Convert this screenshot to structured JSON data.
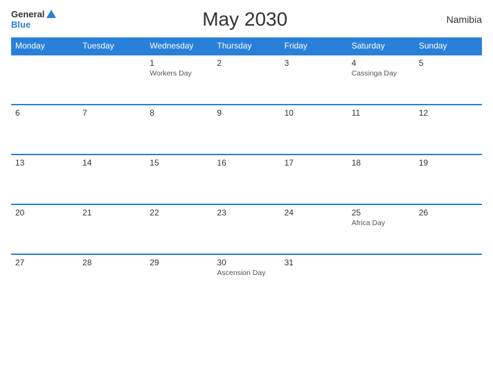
{
  "header": {
    "logo_general": "General",
    "logo_blue": "Blue",
    "title": "May 2030",
    "country": "Namibia"
  },
  "days_of_week": [
    "Monday",
    "Tuesday",
    "Wednesday",
    "Thursday",
    "Friday",
    "Saturday",
    "Sunday"
  ],
  "weeks": [
    [
      {
        "day": "",
        "holiday": ""
      },
      {
        "day": "",
        "holiday": ""
      },
      {
        "day": "1",
        "holiday": "Workers Day"
      },
      {
        "day": "2",
        "holiday": ""
      },
      {
        "day": "3",
        "holiday": ""
      },
      {
        "day": "4",
        "holiday": "Cassinga Day"
      },
      {
        "day": "5",
        "holiday": ""
      }
    ],
    [
      {
        "day": "6",
        "holiday": ""
      },
      {
        "day": "7",
        "holiday": ""
      },
      {
        "day": "8",
        "holiday": ""
      },
      {
        "day": "9",
        "holiday": ""
      },
      {
        "day": "10",
        "holiday": ""
      },
      {
        "day": "11",
        "holiday": ""
      },
      {
        "day": "12",
        "holiday": ""
      }
    ],
    [
      {
        "day": "13",
        "holiday": ""
      },
      {
        "day": "14",
        "holiday": ""
      },
      {
        "day": "15",
        "holiday": ""
      },
      {
        "day": "16",
        "holiday": ""
      },
      {
        "day": "17",
        "holiday": ""
      },
      {
        "day": "18",
        "holiday": ""
      },
      {
        "day": "19",
        "holiday": ""
      }
    ],
    [
      {
        "day": "20",
        "holiday": ""
      },
      {
        "day": "21",
        "holiday": ""
      },
      {
        "day": "22",
        "holiday": ""
      },
      {
        "day": "23",
        "holiday": ""
      },
      {
        "day": "24",
        "holiday": ""
      },
      {
        "day": "25",
        "holiday": "Africa Day"
      },
      {
        "day": "26",
        "holiday": ""
      }
    ],
    [
      {
        "day": "27",
        "holiday": ""
      },
      {
        "day": "28",
        "holiday": ""
      },
      {
        "day": "29",
        "holiday": ""
      },
      {
        "day": "30",
        "holiday": "Ascension Day"
      },
      {
        "day": "31",
        "holiday": ""
      },
      {
        "day": "",
        "holiday": ""
      },
      {
        "day": "",
        "holiday": ""
      }
    ]
  ]
}
